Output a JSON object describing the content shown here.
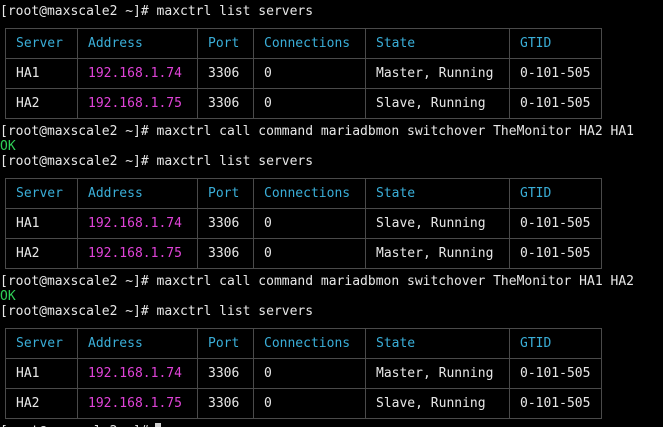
{
  "prompt": "[root@maxscale2 ~]#",
  "columns": [
    "Server",
    "Address",
    "Port",
    "Connections",
    "State",
    "GTID"
  ],
  "blocks": [
    {
      "command": "maxctrl list servers",
      "rows": [
        {
          "server": "HA1",
          "address": "192.168.1.74",
          "port": "3306",
          "connections": "0",
          "state": "Master, Running",
          "gtid": "0-101-505"
        },
        {
          "server": "HA2",
          "address": "192.168.1.75",
          "port": "3306",
          "connections": "0",
          "state": "Slave, Running",
          "gtid": "0-101-505"
        }
      ]
    },
    {
      "command": "maxctrl list servers",
      "rows": [
        {
          "server": "HA1",
          "address": "192.168.1.74",
          "port": "3306",
          "connections": "0",
          "state": "Slave, Running",
          "gtid": "0-101-505"
        },
        {
          "server": "HA2",
          "address": "192.168.1.75",
          "port": "3306",
          "connections": "0",
          "state": "Master, Running",
          "gtid": "0-101-505"
        }
      ]
    },
    {
      "command": "maxctrl list servers",
      "rows": [
        {
          "server": "HA1",
          "address": "192.168.1.74",
          "port": "3306",
          "connections": "0",
          "state": "Master, Running",
          "gtid": "0-101-505"
        },
        {
          "server": "HA2",
          "address": "192.168.1.75",
          "port": "3306",
          "connections": "0",
          "state": "Slave, Running",
          "gtid": "0-101-505"
        }
      ]
    }
  ],
  "switchovers": [
    {
      "command": "maxctrl call command mariadbmon switchover TheMonitor HA2 HA1",
      "result": "OK"
    },
    {
      "command": "maxctrl call command mariadbmon switchover TheMonitor HA1 HA2",
      "result": "OK"
    }
  ],
  "colors": {
    "background": "#000000",
    "text": "#e8e8e8",
    "header": "#3aaed8",
    "address": "#e043d8",
    "ok": "#2fcf56",
    "border": "#4a4a4a"
  }
}
